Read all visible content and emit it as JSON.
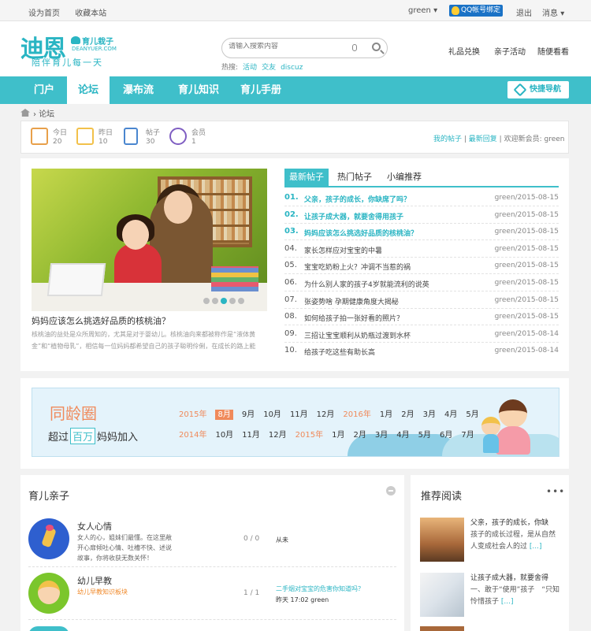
{
  "topbar": {
    "set_home": "设为首页",
    "bookmark": "收藏本站",
    "user": "green",
    "qq": "QQ帐号绑定",
    "logout": "退出",
    "messages": "消息"
  },
  "logo": {
    "main": "迪恩",
    "sub": "育儿栽子",
    "domain": "DEANYUER.COM",
    "slogan": "陪伴育儿每一天"
  },
  "search": {
    "placeholder": "请输入搜索内容",
    "hot_label": "热搜:",
    "hot": [
      "活动",
      "交友",
      "discuz"
    ]
  },
  "header_links": [
    "礼品兑换",
    "亲子活动",
    "随便看看"
  ],
  "nav": {
    "items": [
      "门户",
      "论坛",
      "瀑布流",
      "育儿知识",
      "育儿手册"
    ],
    "active": "论坛",
    "quick": "快捷导航"
  },
  "breadcrumb": {
    "current": "论坛"
  },
  "stats": {
    "items": [
      {
        "label": "今日",
        "value": "20"
      },
      {
        "label": "昨日",
        "value": "10"
      },
      {
        "label": "帖子",
        "value": "30"
      },
      {
        "label": "会员",
        "value": "1"
      }
    ],
    "my_posts": "我的帖子",
    "latest_replies": "最新回复",
    "welcome": "欢迎新会员:",
    "new_member": "green"
  },
  "featured": {
    "title": "妈妈应该怎么挑选好品质的核桃油？",
    "desc": "核桃油的益处是众所周知的，尤其是对于婴幼儿。核桃油向来都被称作是“液体黄金”和“植物母乳”，相信每一位妈妈都希望自己的孩子聪明伶俐，在成长的路上能"
  },
  "tabs": [
    "最新帖子",
    "热门帖子",
    "小编推荐"
  ],
  "posts": [
    {
      "num": "01.",
      "title": "父亲，孩子的成长，你缺席了吗？",
      "meta": "green/2015-08-15",
      "hl": true
    },
    {
      "num": "02.",
      "title": "让孩子成大器，就要舍得用孩子",
      "meta": "green/2015-08-15",
      "hl": true
    },
    {
      "num": "03.",
      "title": "妈妈应该怎么挑选好品质的核桃油？",
      "meta": "green/2015-08-15",
      "hl": true
    },
    {
      "num": "04.",
      "title": "家长怎样应对宝宝的中暑",
      "meta": "green/2015-08-15",
      "hl": false
    },
    {
      "num": "05.",
      "title": "宝宝吃奶粉上火？冲调不当惹的祸",
      "meta": "green/2015-08-15",
      "hl": false
    },
    {
      "num": "06.",
      "title": "为什么别人家的孩子4岁就能流利的说英",
      "meta": "green/2015-08-15",
      "hl": false
    },
    {
      "num": "07.",
      "title": "张姿势啥 孕期健康角度大揭秘",
      "meta": "green/2015-08-15",
      "hl": false
    },
    {
      "num": "08.",
      "title": "如何给孩子拍一张好看的照片？",
      "meta": "green/2015-08-15",
      "hl": false
    },
    {
      "num": "09.",
      "title": "三招让宝宝顺利从奶瓶过渡到水杯",
      "meta": "green/2015-08-14",
      "hl": false
    },
    {
      "num": "10.",
      "title": "给孩子吃这些有助长高",
      "meta": "green/2015-08-14",
      "hl": false
    }
  ],
  "banner": {
    "title": "同龄圈",
    "sub_pre": "超过",
    "sub_hl": "百万",
    "sub_post": "妈妈加入",
    "row1": [
      {
        "t": "2015年",
        "y": true
      },
      {
        "t": "8月",
        "sel": true
      },
      {
        "t": "9月"
      },
      {
        "t": "10月"
      },
      {
        "t": "11月"
      },
      {
        "t": "12月"
      },
      {
        "t": "2016年",
        "y": true
      },
      {
        "t": "1月"
      },
      {
        "t": "2月"
      },
      {
        "t": "3月"
      },
      {
        "t": "4月"
      },
      {
        "t": "5月"
      }
    ],
    "row2": [
      {
        "t": "2014年",
        "y": true
      },
      {
        "t": "10月"
      },
      {
        "t": "11月"
      },
      {
        "t": "12月"
      },
      {
        "t": "2015年",
        "y": true
      },
      {
        "t": "1月"
      },
      {
        "t": "2月"
      },
      {
        "t": "3月"
      },
      {
        "t": "4月"
      },
      {
        "t": "5月"
      },
      {
        "t": "6月"
      },
      {
        "t": "7月"
      }
    ]
  },
  "forums": {
    "title": "育儿亲子",
    "items": [
      {
        "name": "女人心情",
        "desc": "女人的心，姐妹们最懂。在这里敞开心扉倾吐心情、吐槽不快、述说故事，你将收获无数关怀！",
        "count": "0 / 0",
        "last": "从未",
        "last_title": "",
        "color": "#2e5fcf"
      },
      {
        "name": "幼儿早教",
        "desc": "幼儿早教知识板块",
        "count": "1 / 1",
        "last": "昨天 17:02 green",
        "last_title": "二手烟对宝宝的危害你知道吗？",
        "color": "#7bc62c"
      }
    ]
  },
  "recommend": {
    "title": "推荐阅读",
    "more": "•••",
    "items": [
      {
        "title": "父亲，孩子的成长，你缺",
        "desc": "孩子的成长过程，是从自然人变成社会人的过",
        "more": "[...]"
      },
      {
        "title": "让孩子成大器，就要舍得",
        "desc": "一、敢于“使用”孩子　“只知怜惜孩子",
        "more": "[...]"
      }
    ]
  },
  "colors": {
    "accent": "#3fbfca",
    "orange": "#f08a5b"
  }
}
